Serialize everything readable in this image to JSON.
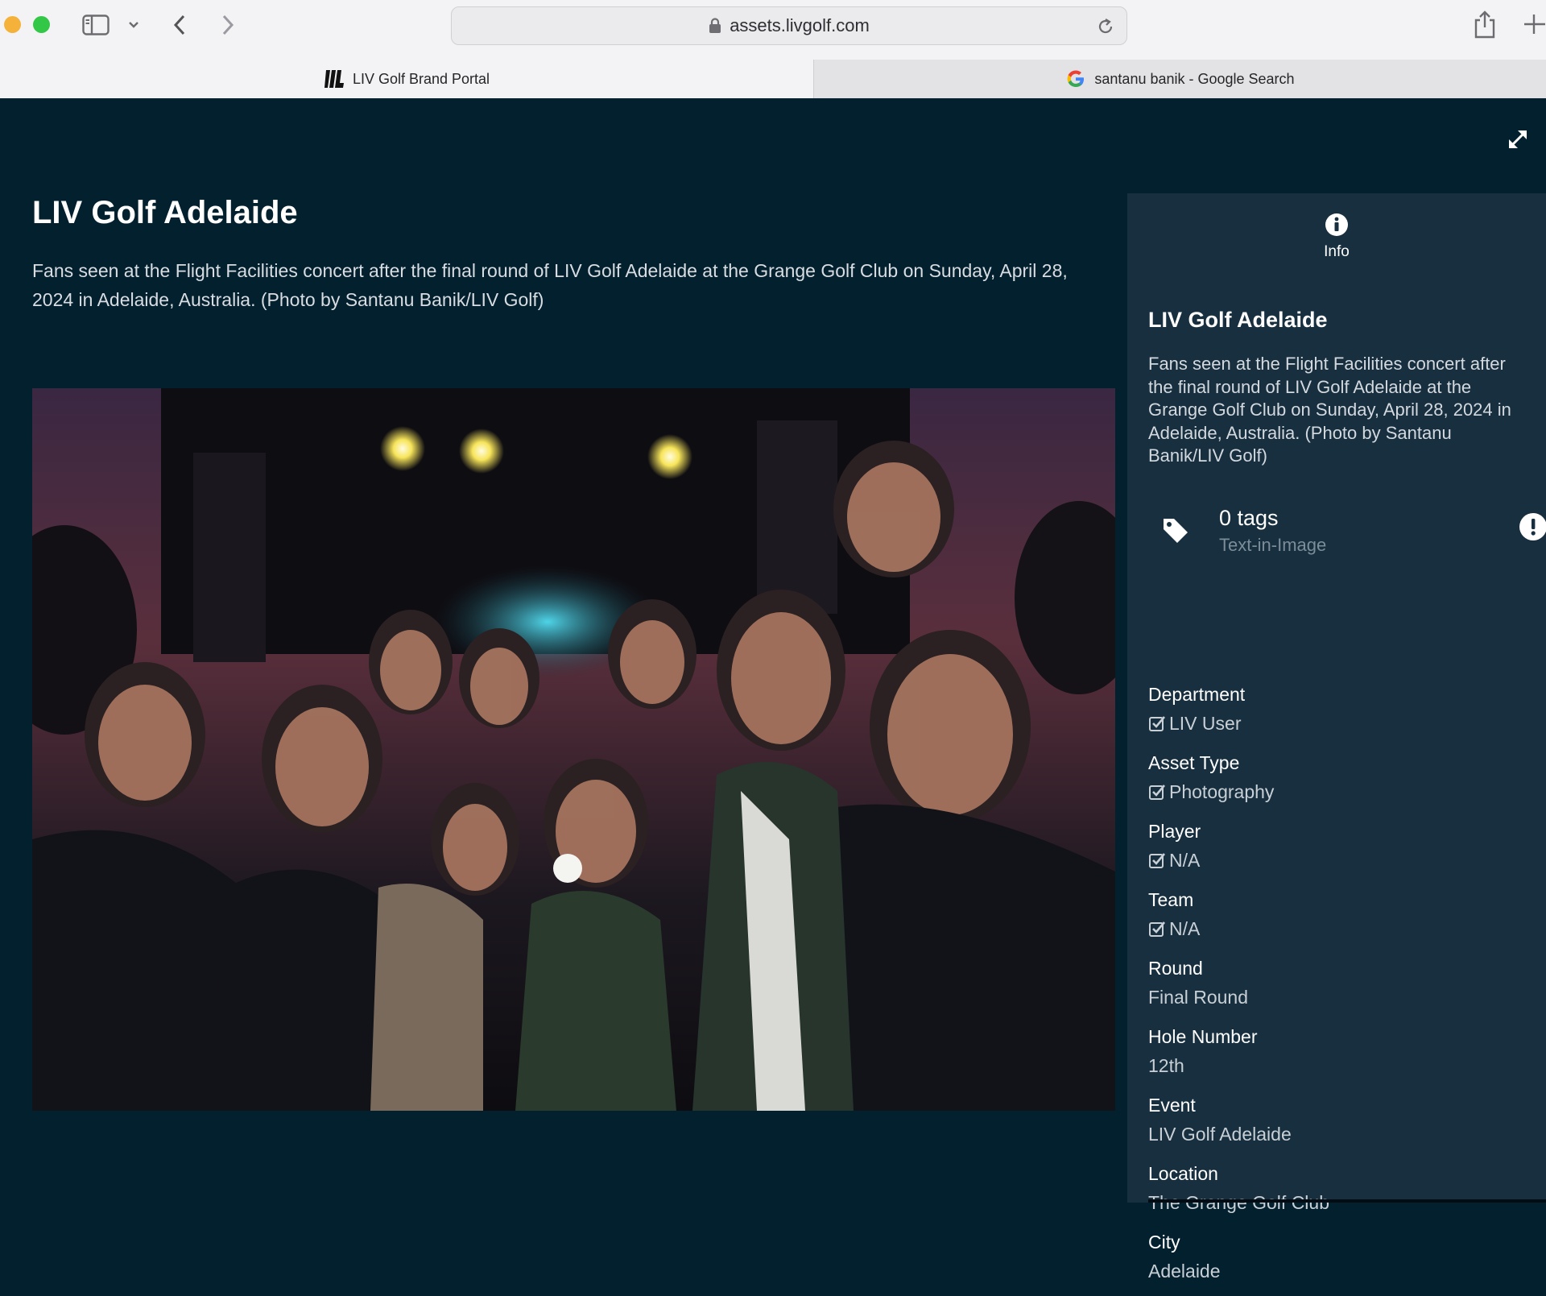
{
  "browser": {
    "url": "assets.livgolf.com",
    "tabs": [
      {
        "title": "LIV Golf Brand Portal",
        "icon": "liv-golf-icon",
        "active": true
      },
      {
        "title": "santanu banik - Google Search",
        "icon": "google-icon",
        "active": false
      }
    ]
  },
  "asset": {
    "title": "LIV Golf Adelaide",
    "description": "Fans seen at the Flight Facilities concert after the final round of LIV Golf Adelaide at the Grange Golf Club on Sunday, April 28, 2024 in Adelaide, Australia. (Photo by Santanu Banik/LIV Golf)",
    "image_alt": "photo"
  },
  "panel": {
    "info_label": "Info",
    "title": "LIV Golf Adelaide",
    "description": "Fans seen at the Flight Facilities concert after the final round of LIV Golf Adelaide at the Grange Golf Club on Sunday, April 28, 2024 in Adelaide, Australia. (Photo by Santanu Banik/LIV Golf)",
    "tags_count": "0 tags",
    "tags_sub": "Text-in-Image",
    "fields": [
      {
        "label": "Department",
        "value": "LIV User",
        "checkbox": true
      },
      {
        "label": "Asset Type",
        "value": "Photography",
        "checkbox": true
      },
      {
        "label": "Player",
        "value": "N/A",
        "checkbox": true
      },
      {
        "label": "Team",
        "value": "N/A",
        "checkbox": true
      },
      {
        "label": "Round",
        "value": "Final Round",
        "checkbox": false
      },
      {
        "label": "Hole Number",
        "value": "12th",
        "checkbox": false
      },
      {
        "label": "Event",
        "value": "LIV Golf Adelaide",
        "checkbox": false
      },
      {
        "label": "Location",
        "value": "The Grange Golf Club",
        "checkbox": false
      },
      {
        "label": "City",
        "value": "Adelaide",
        "checkbox": false
      }
    ]
  },
  "colors": {
    "page_bg": "#03202f",
    "panel_bg": "#172f3f",
    "chrome_bg": "#f3f2f4"
  }
}
